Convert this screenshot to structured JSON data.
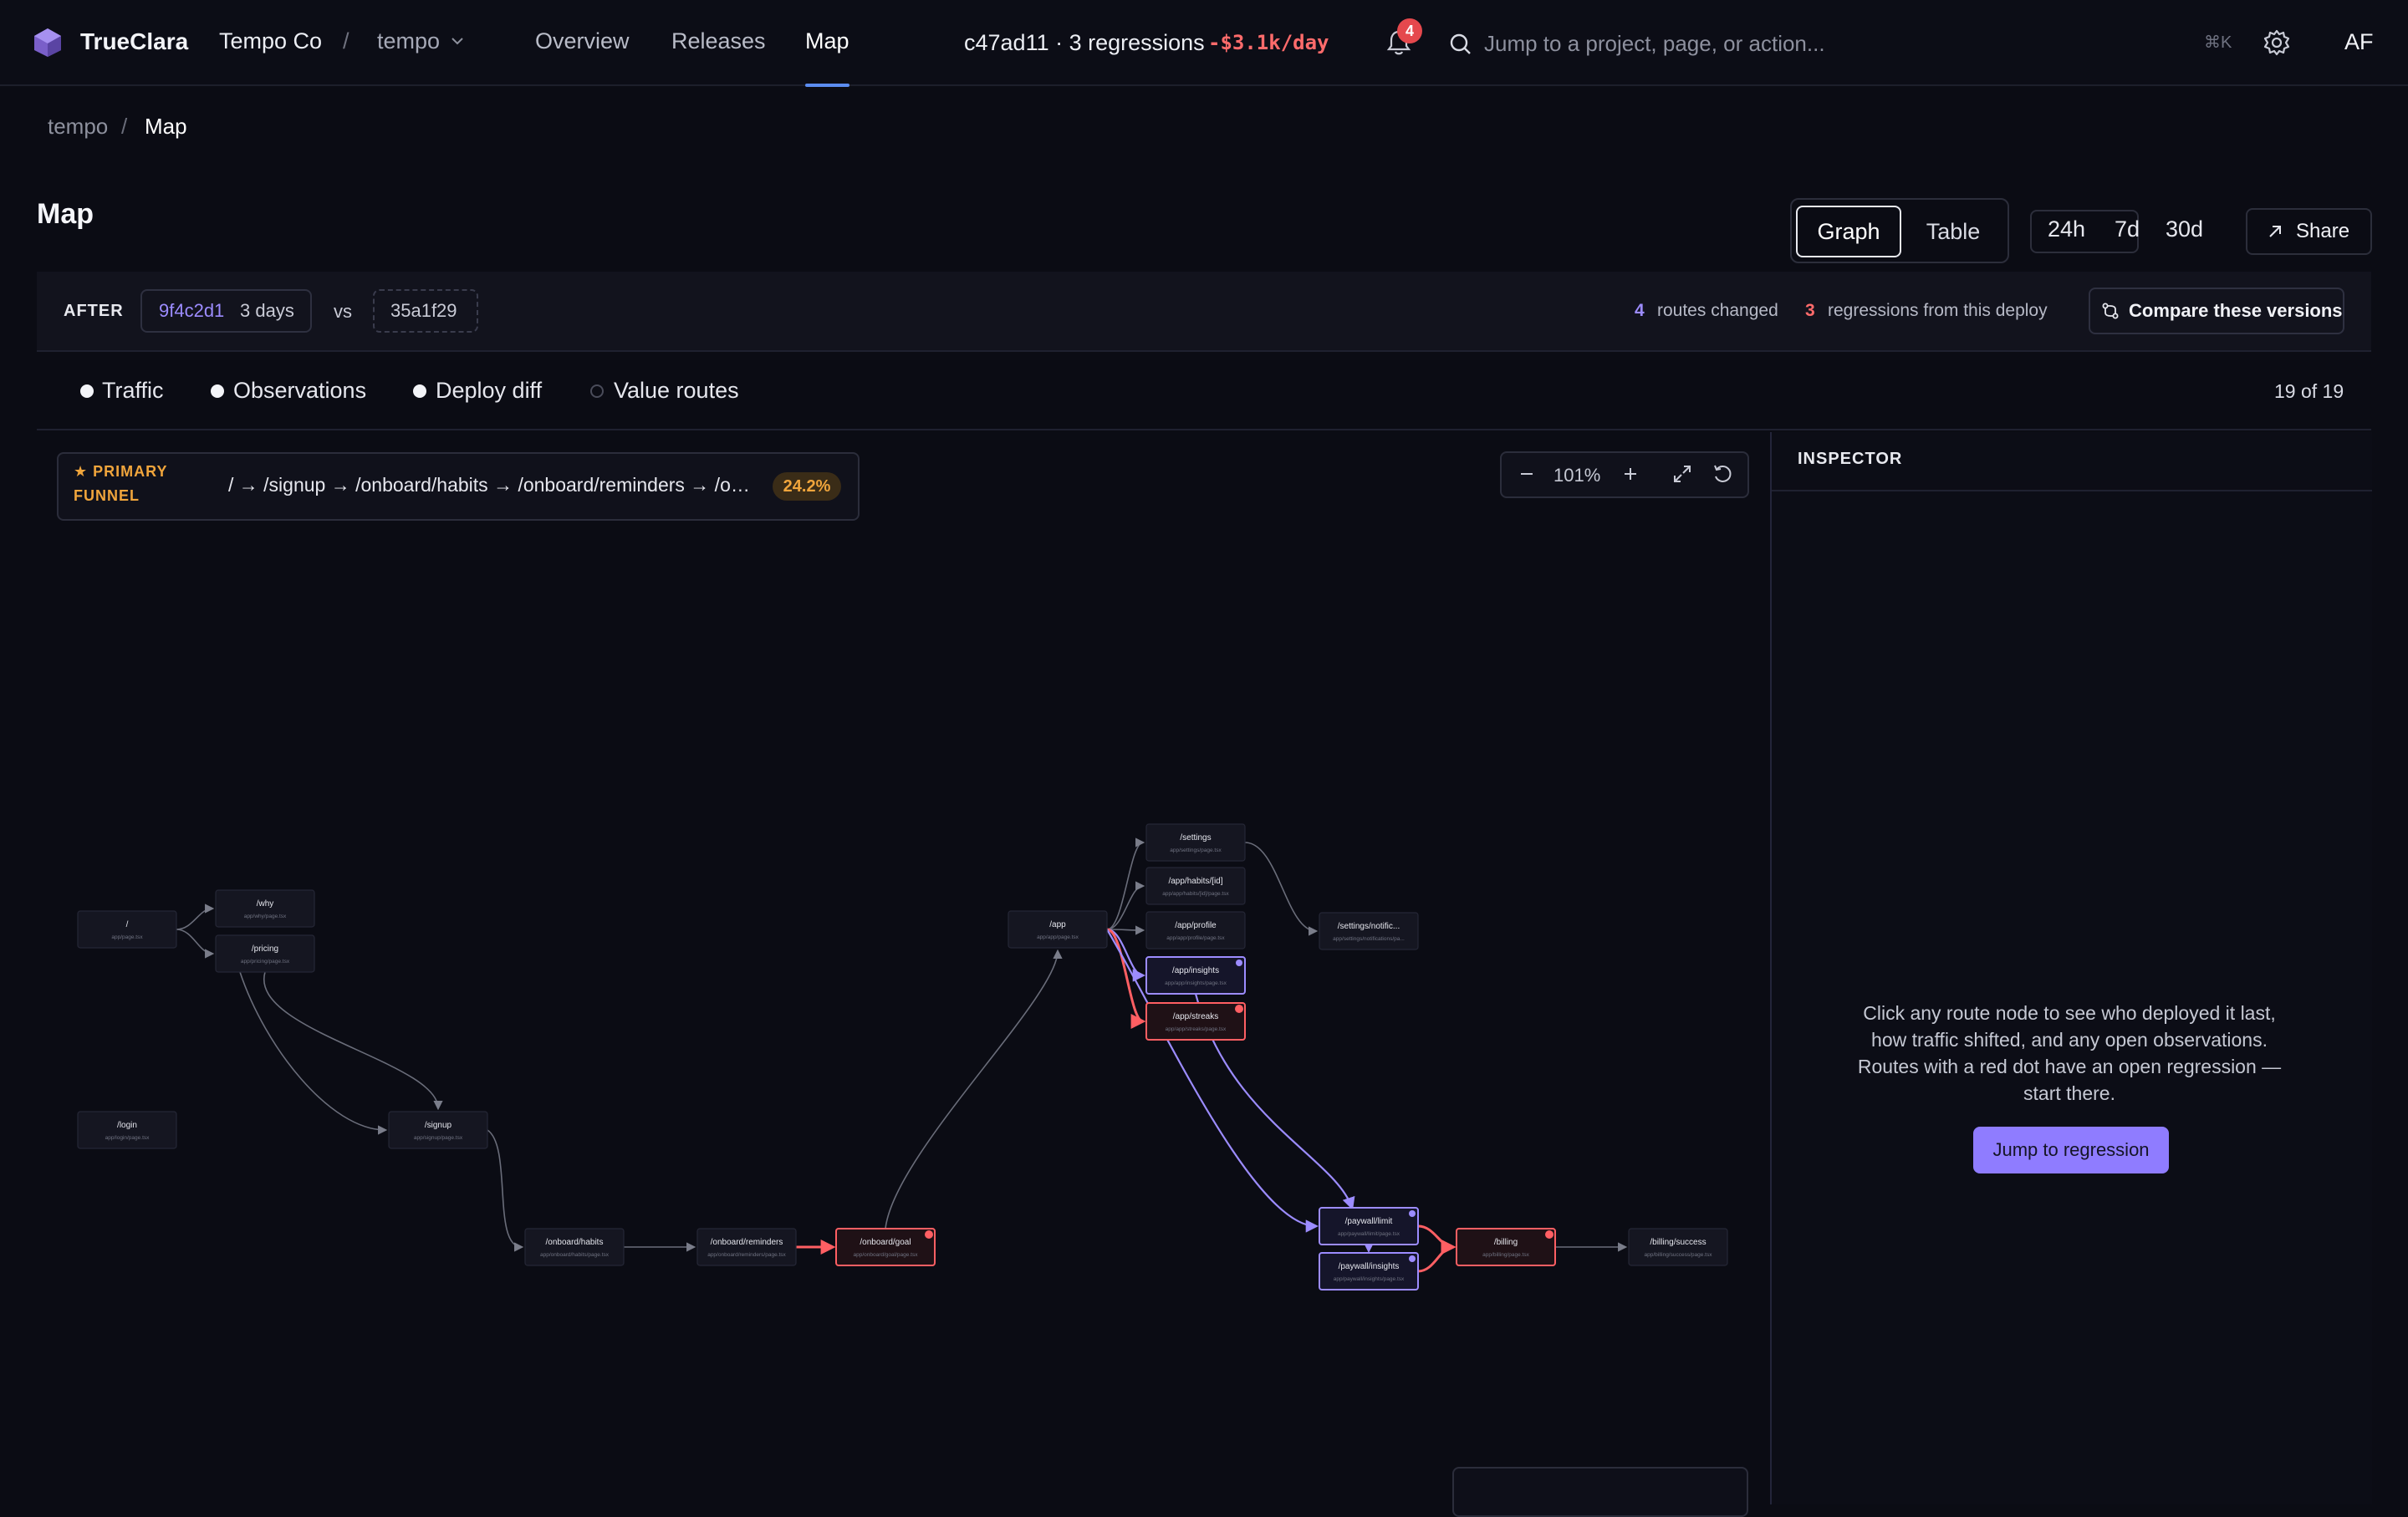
{
  "app": {
    "brand": "TrueClara",
    "org": "Tempo Co",
    "project": "tempo"
  },
  "nav": {
    "items": [
      {
        "label": "Overview"
      },
      {
        "label": "Releases"
      },
      {
        "label": "Map"
      }
    ],
    "active": "Map"
  },
  "header": {
    "commit_summary": "c47ad11 · 3 regressions",
    "cost": "-$3.1k/day",
    "notifications": "4",
    "search_placeholder": "Jump to a project, page, or action...",
    "shortcut": "⌘K",
    "avatar": "AF"
  },
  "breadcrumb": {
    "root": "tempo",
    "sep": "/",
    "current": "Map"
  },
  "page": {
    "title": "Map"
  },
  "view_toggle": {
    "graph": "Graph",
    "table": "Table",
    "active": "Graph"
  },
  "range": {
    "options": [
      "24h",
      "7d",
      "30d"
    ]
  },
  "share": {
    "label": "Share"
  },
  "deploy": {
    "after_label": "AFTER",
    "after_hash": "9f4c2d1",
    "after_age": "3 days",
    "vs": "vs",
    "before_hash": "35a1f29",
    "routes_changed_count": "4",
    "routes_changed_label": "routes changed",
    "regressions_count": "3",
    "regressions_label": "regressions from this deploy",
    "compare_label": "Compare these versions"
  },
  "filters": {
    "items": [
      {
        "label": "Traffic",
        "on": true
      },
      {
        "label": "Observations",
        "on": true
      },
      {
        "label": "Deploy diff",
        "on": true
      },
      {
        "label": "Value routes",
        "on": false
      }
    ],
    "count": "19 of 19"
  },
  "funnel": {
    "tag_line1": "★ PRIMARY",
    "tag_line2": "FUNNEL",
    "path": "/ → /signup → /onboard/habits → /onboard/reminders → /onboard/goal → /app → /paywall/limit → /billing → /billing/success",
    "pct": "24.2%"
  },
  "zoom": {
    "value": "101%"
  },
  "inspector": {
    "title": "INSPECTOR",
    "hint": "Click any route node to see who deployed it last, how traffic shifted, and any open observations. Routes with a red dot have an open regression — start there.",
    "jump_label": "Jump to regression"
  },
  "colors": {
    "accent": "#8f7cff",
    "regression": "#ff6b6b",
    "funnel": "#f0a53c",
    "nav_underline": "#5b8cf0"
  },
  "graph": {
    "nodes": [
      {
        "id": "root",
        "title": "/",
        "file": "app/page.tsx",
        "state": "normal"
      },
      {
        "id": "why",
        "title": "/why",
        "file": "app/why/page.tsx",
        "state": "normal"
      },
      {
        "id": "pricing",
        "title": "/pricing",
        "file": "app/pricing/page.tsx",
        "state": "normal"
      },
      {
        "id": "login",
        "title": "/login",
        "file": "app/login/page.tsx",
        "state": "normal"
      },
      {
        "id": "signup",
        "title": "/signup",
        "file": "app/signup/page.tsx",
        "state": "normal"
      },
      {
        "id": "habits",
        "title": "/onboard/habits",
        "file": "app/onboard/habits/page.tsx",
        "state": "normal"
      },
      {
        "id": "reminders",
        "title": "/onboard/reminders",
        "file": "app/onboard/reminders/page.tsx",
        "state": "normal"
      },
      {
        "id": "goal",
        "title": "/onboard/goal",
        "file": "app/onboard/goal/page.tsx",
        "state": "regression"
      },
      {
        "id": "app",
        "title": "/app",
        "file": "app/app/page.tsx",
        "state": "normal"
      },
      {
        "id": "settings",
        "title": "/settings",
        "file": "app/settings/page.tsx",
        "state": "normal"
      },
      {
        "id": "habitid",
        "title": "/app/habits/[id]",
        "file": "app/app/habits/[id]/page.tsx",
        "state": "normal"
      },
      {
        "id": "profile",
        "title": "/app/profile",
        "file": "app/app/profile/page.tsx",
        "state": "normal"
      },
      {
        "id": "insights",
        "title": "/app/insights",
        "file": "app/app/insights/page.tsx",
        "state": "changed"
      },
      {
        "id": "streaks",
        "title": "/app/streaks",
        "file": "app/app/streaks/page.tsx",
        "state": "regression"
      },
      {
        "id": "notif",
        "title": "/settings/notific...",
        "file": "app/settings/notifications/pa...",
        "state": "normal"
      },
      {
        "id": "plimit",
        "title": "/paywall/limit",
        "file": "app/paywall/limit/page.tsx",
        "state": "changed"
      },
      {
        "id": "pinsights",
        "title": "/paywall/insights",
        "file": "app/paywall/insights/page.tsx",
        "state": "changed"
      },
      {
        "id": "billing",
        "title": "/billing",
        "file": "app/billing/page.tsx",
        "state": "regression"
      },
      {
        "id": "bsuccess",
        "title": "/billing/success",
        "file": "app/billing/success/page.tsx",
        "state": "normal"
      }
    ]
  }
}
